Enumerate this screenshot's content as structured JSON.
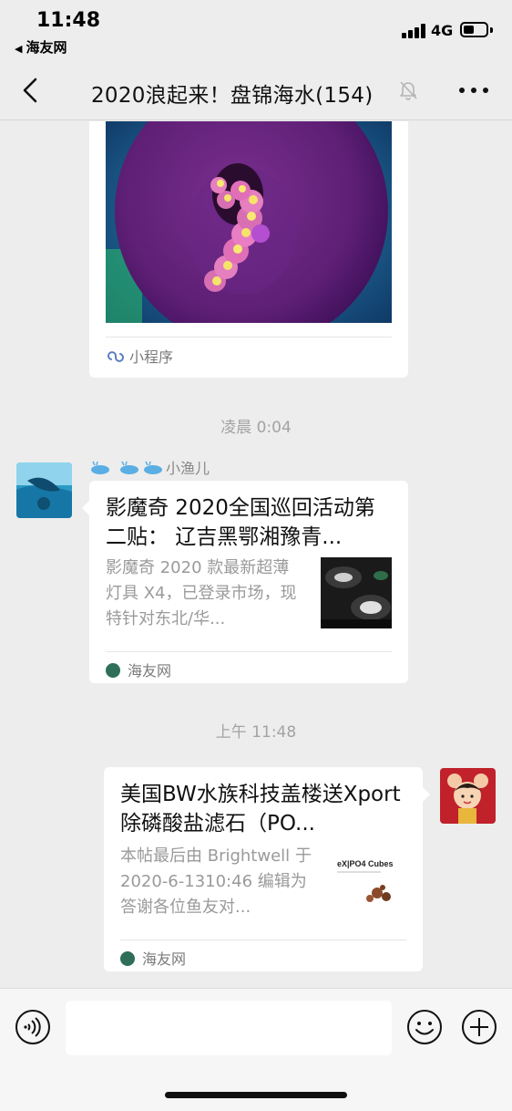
{
  "status_bar": {
    "time": "11:48",
    "back_app": "海友网",
    "network": "4G"
  },
  "nav": {
    "title": "2020浪起来！盘锦海水(154)",
    "back_icon": "chevron-left-icon",
    "mute_icon": "bell-off-icon",
    "more_icon": "more-dots-icon"
  },
  "messages": {
    "mini_program": {
      "label": "小程序"
    },
    "timestamp_1": "凌晨 0:04",
    "sender_name": "小渔儿",
    "link_1": {
      "title": "影魔奇 2020全国巡回活动第二贴： 辽吉黑鄂湘豫青...",
      "desc": "影魔奇 2020 款最新超薄灯具 X4，已登录市场，现特针对东北/华...",
      "source": "海友网"
    },
    "timestamp_2": "上午 11:48",
    "link_2": {
      "title": "美国BW水族科技盖楼送Xport除磷酸盐滤石（PO...",
      "desc": "本帖最后由 Brightwell 于 2020-6-1310:46 编辑为答谢各位鱼友对...",
      "source": "海友网",
      "thumb_text": "eX|PO4 Cubes"
    }
  },
  "input": {
    "value": "",
    "placeholder": ""
  },
  "colors": {
    "background": "#ededed",
    "bubble": "#ffffff",
    "timestamp": "#a3a3a3",
    "secondary_text": "#9a9a9a"
  }
}
